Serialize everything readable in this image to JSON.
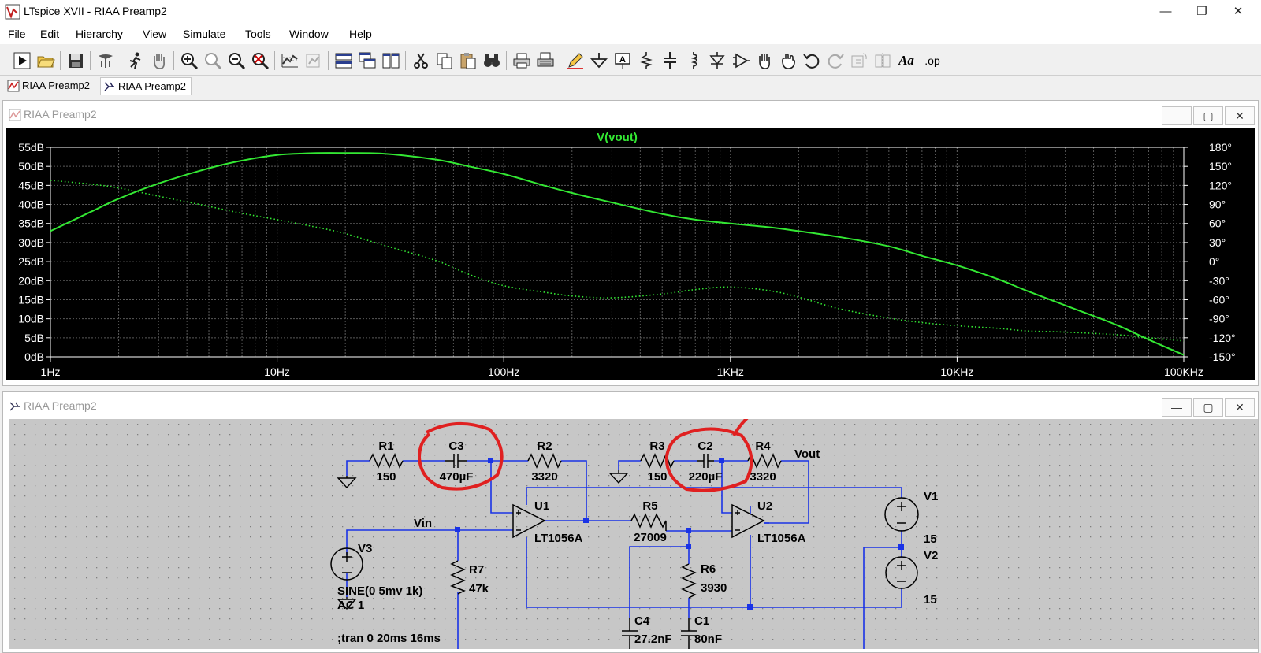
{
  "window": {
    "title": "LTspice XVII - RIAA Preamp2",
    "min": "—",
    "max": "❐",
    "close": "✕"
  },
  "menu": [
    "File",
    "Edit",
    "Hierarchy",
    "View",
    "Simulate",
    "Tools",
    "Window",
    "Help"
  ],
  "toolbar_icons": [
    "run-icon",
    "open-icon",
    "save-icon",
    "control-panel-icon",
    "run-man-icon",
    "pan-hand-icon",
    "zoom-in-icon",
    "zoom-area-icon",
    "zoom-out-icon",
    "zoom-cancel-icon",
    "autorange-icon",
    "plot-settings-icon",
    "tile-horizontal-icon",
    "cascade-icon",
    "tile-vertical-icon",
    "cut-icon",
    "copy-icon",
    "paste-icon",
    "find-icon",
    "print-icon",
    "print-setup-icon",
    "pencil-icon",
    "ground-icon",
    "label-net-icon",
    "resistor-icon",
    "capacitor-icon",
    "inductor-icon",
    "diode-icon",
    "component-icon",
    "move-icon",
    "drag-icon",
    "undo-icon",
    "redo-icon",
    "rotate-icon",
    "mirror-icon",
    "text-icon",
    "spice-directive-icon"
  ],
  "toolbar_text": {
    "text_tool": "Aa",
    "op_tool": ".op"
  },
  "tabs": [
    {
      "label": "RIAA Preamp2"
    },
    {
      "label": "RIAA Preamp2"
    }
  ],
  "plot_window": {
    "title": "RIAA Preamp2",
    "btn_min": "—",
    "btn_max": "▢",
    "btn_close": "✕"
  },
  "schematic_window": {
    "title": "RIAA Preamp2",
    "btn_min": "—",
    "btn_max": "▢",
    "btn_close": "✕"
  },
  "colors": {
    "trace": "#33e833",
    "plot_bg": "#000000",
    "grid": "#5a5a5a",
    "axis_text": "#ffffff",
    "wire": "#1a33e6",
    "schematic_bg": "#c7c7c7",
    "dot": "#808080",
    "annotation": "#e02020"
  },
  "chart_data": {
    "type": "line",
    "title": "V(vout)",
    "x_scale": "log",
    "xlim": [
      1,
      100000
    ],
    "x_ticks": [
      "1Hz",
      "10Hz",
      "100Hz",
      "1KHz",
      "10KHz",
      "100KHz"
    ],
    "y_ticks": [
      "0dB",
      "5dB",
      "10dB",
      "15dB",
      "20dB",
      "25dB",
      "30dB",
      "35dB",
      "40dB",
      "45dB",
      "50dB",
      "55dB"
    ],
    "ylim": [
      0,
      55
    ],
    "y2_ticks": [
      "-150°",
      "-120°",
      "-90°",
      "-60°",
      "-30°",
      "0°",
      "30°",
      "60°",
      "90°",
      "120°",
      "150°",
      "180°"
    ],
    "y2lim": [
      -150,
      180
    ],
    "grid": true,
    "series": [
      {
        "name": "V(vout)",
        "style": "solid",
        "axis": "left",
        "x": [
          1,
          1.5,
          2,
          3,
          5,
          7,
          10,
          15,
          20,
          30,
          50,
          70,
          100,
          150,
          200,
          300,
          500,
          700,
          1000,
          1500,
          2000,
          3000,
          5000,
          7000,
          10000,
          15000,
          20000,
          30000,
          50000,
          70000,
          100000
        ],
        "y": [
          33,
          38,
          41.5,
          45.5,
          49.5,
          51.5,
          53,
          53.5,
          53.5,
          53.3,
          51.8,
          50,
          48,
          45,
          43,
          40.5,
          37.5,
          36,
          35,
          34,
          33,
          31.5,
          29,
          26.5,
          24,
          20.5,
          17.5,
          13.5,
          8.5,
          4.5,
          0.5
        ]
      },
      {
        "name": "phase",
        "style": "dotted",
        "axis": "right",
        "x": [
          1,
          1.5,
          2,
          3,
          5,
          7,
          10,
          15,
          20,
          30,
          50,
          70,
          100,
          150,
          200,
          300,
          500,
          700,
          1000,
          1500,
          2000,
          3000,
          5000,
          7000,
          10000,
          15000,
          20000,
          30000,
          50000,
          70000,
          100000
        ],
        "y": [
          128,
          122,
          116,
          103,
          87,
          76,
          66,
          54,
          44,
          25,
          2,
          -20,
          -38,
          -48,
          -54,
          -57,
          -51,
          -44,
          -40,
          -46,
          -56,
          -74,
          -89,
          -96,
          -101,
          -105,
          -109,
          -111,
          -115,
          -120,
          -125
        ]
      }
    ]
  },
  "schematic": {
    "components": [
      {
        "ref": "R1",
        "value": "150"
      },
      {
        "ref": "C3",
        "value": "470µF"
      },
      {
        "ref": "R2",
        "value": "3320"
      },
      {
        "ref": "R3",
        "value": "150"
      },
      {
        "ref": "C2",
        "value": "220µF"
      },
      {
        "ref": "R4",
        "value": "3320"
      },
      {
        "ref": "U1",
        "value": "LT1056A"
      },
      {
        "ref": "U2",
        "value": "LT1056A"
      },
      {
        "ref": "R5",
        "value": "27009"
      },
      {
        "ref": "R6",
        "value": "3930"
      },
      {
        "ref": "R7",
        "value": "47k"
      },
      {
        "ref": "V1",
        "value": "15"
      },
      {
        "ref": "V2",
        "value": "15"
      },
      {
        "ref": "V3",
        "value": "SINE(0 5mv 1k)",
        "extra": "AC 1"
      },
      {
        "ref": "C4",
        "value": "27.2nF"
      },
      {
        "ref": "C1",
        "value": "80nF"
      }
    ],
    "nets": {
      "vin": "Vin",
      "vout": "Vout"
    },
    "directive": ";tran 0 20ms 16ms"
  }
}
